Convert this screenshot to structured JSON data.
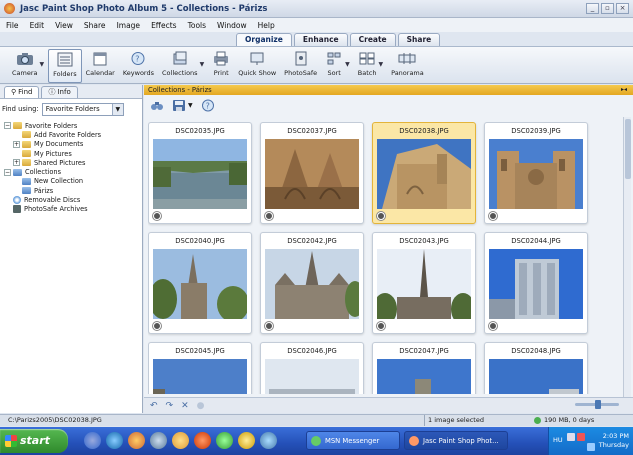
{
  "window": {
    "title": "Jasc Paint Shop Photo Album 5 - Collections - Párizs",
    "buttons": [
      "_",
      "▫",
      "×"
    ]
  },
  "menu": [
    "File",
    "Edit",
    "View",
    "Share",
    "Image",
    "Effects",
    "Tools",
    "Window",
    "Help"
  ],
  "mode_tabs": [
    {
      "label": "Organize",
      "active": true
    },
    {
      "label": "Enhance",
      "active": false
    },
    {
      "label": "Create",
      "active": false
    },
    {
      "label": "Share",
      "active": false
    }
  ],
  "toolbar": {
    "camera": "Camera",
    "folders": "Folders",
    "calendar": "Calendar",
    "keywords": "Keywords",
    "collections": "Collections",
    "print": "Print",
    "quick_show": "Quick Show",
    "photosafe": "PhotoSafe",
    "sort": "Sort",
    "batch": "Batch",
    "panorama": "Panorama"
  },
  "left_panel": {
    "tabs": [
      {
        "label": "Find",
        "active": true
      },
      {
        "label": "Info",
        "active": false
      }
    ],
    "find_using_label": "Find using:",
    "find_using_value": "Favorite Folders",
    "tree": {
      "favorite_folders": "Favorite Folders",
      "add_favorite": "Add Favorite Folders",
      "my_documents": "My Documents",
      "my_pictures": "My Pictures",
      "shared_pictures": "Shared Pictures",
      "collections": "Collections",
      "new_collection": "New Collection",
      "parizs": "Párizs",
      "removable": "Removable Discs",
      "photosafe": "PhotoSafe Archives"
    }
  },
  "main": {
    "header": "Collections - Párizs",
    "thumbnails": [
      {
        "name": "DSC02035.JPG",
        "selected": false,
        "scene": "canal"
      },
      {
        "name": "DSC02037.JPG",
        "selected": false,
        "scene": "facade-warm"
      },
      {
        "name": "DSC02038.JPG",
        "selected": true,
        "scene": "cathedral-sky"
      },
      {
        "name": "DSC02039.JPG",
        "selected": false,
        "scene": "cathedral-front"
      },
      {
        "name": "DSC02040.JPG",
        "selected": false,
        "scene": "spire-trees"
      },
      {
        "name": "DSC02042.JPG",
        "selected": false,
        "scene": "gothic-side"
      },
      {
        "name": "DSC02043.JPG",
        "selected": false,
        "scene": "spire-tall"
      },
      {
        "name": "DSC02044.JPG",
        "selected": false,
        "scene": "modern-building"
      },
      {
        "name": "DSC02045.JPG",
        "selected": false,
        "scene": "sky-partial"
      },
      {
        "name": "DSC02046.JPG",
        "selected": false,
        "scene": "building-partial"
      },
      {
        "name": "DSC02047.JPG",
        "selected": false,
        "scene": "sky-partial2"
      },
      {
        "name": "DSC02048.JPG",
        "selected": false,
        "scene": "sky-partial3"
      }
    ]
  },
  "status": {
    "path": "C:\\Parizs2005\\DSC02038.JPG",
    "selection": "1 image selected",
    "disk": "190 MB, 0 days"
  },
  "taskbar": {
    "start": "start",
    "items": [
      {
        "label": "MSN Messenger",
        "active": false
      },
      {
        "label": "Jasc Paint Shop Phot...",
        "active": true
      }
    ],
    "tray_lang": "HU",
    "time": "2:03 PM",
    "day": "Thursday"
  },
  "colors": {
    "accent": "#e3a722",
    "selection": "#fbe7a6",
    "taskbar": "#2450b7",
    "start": "#3a9a36"
  }
}
